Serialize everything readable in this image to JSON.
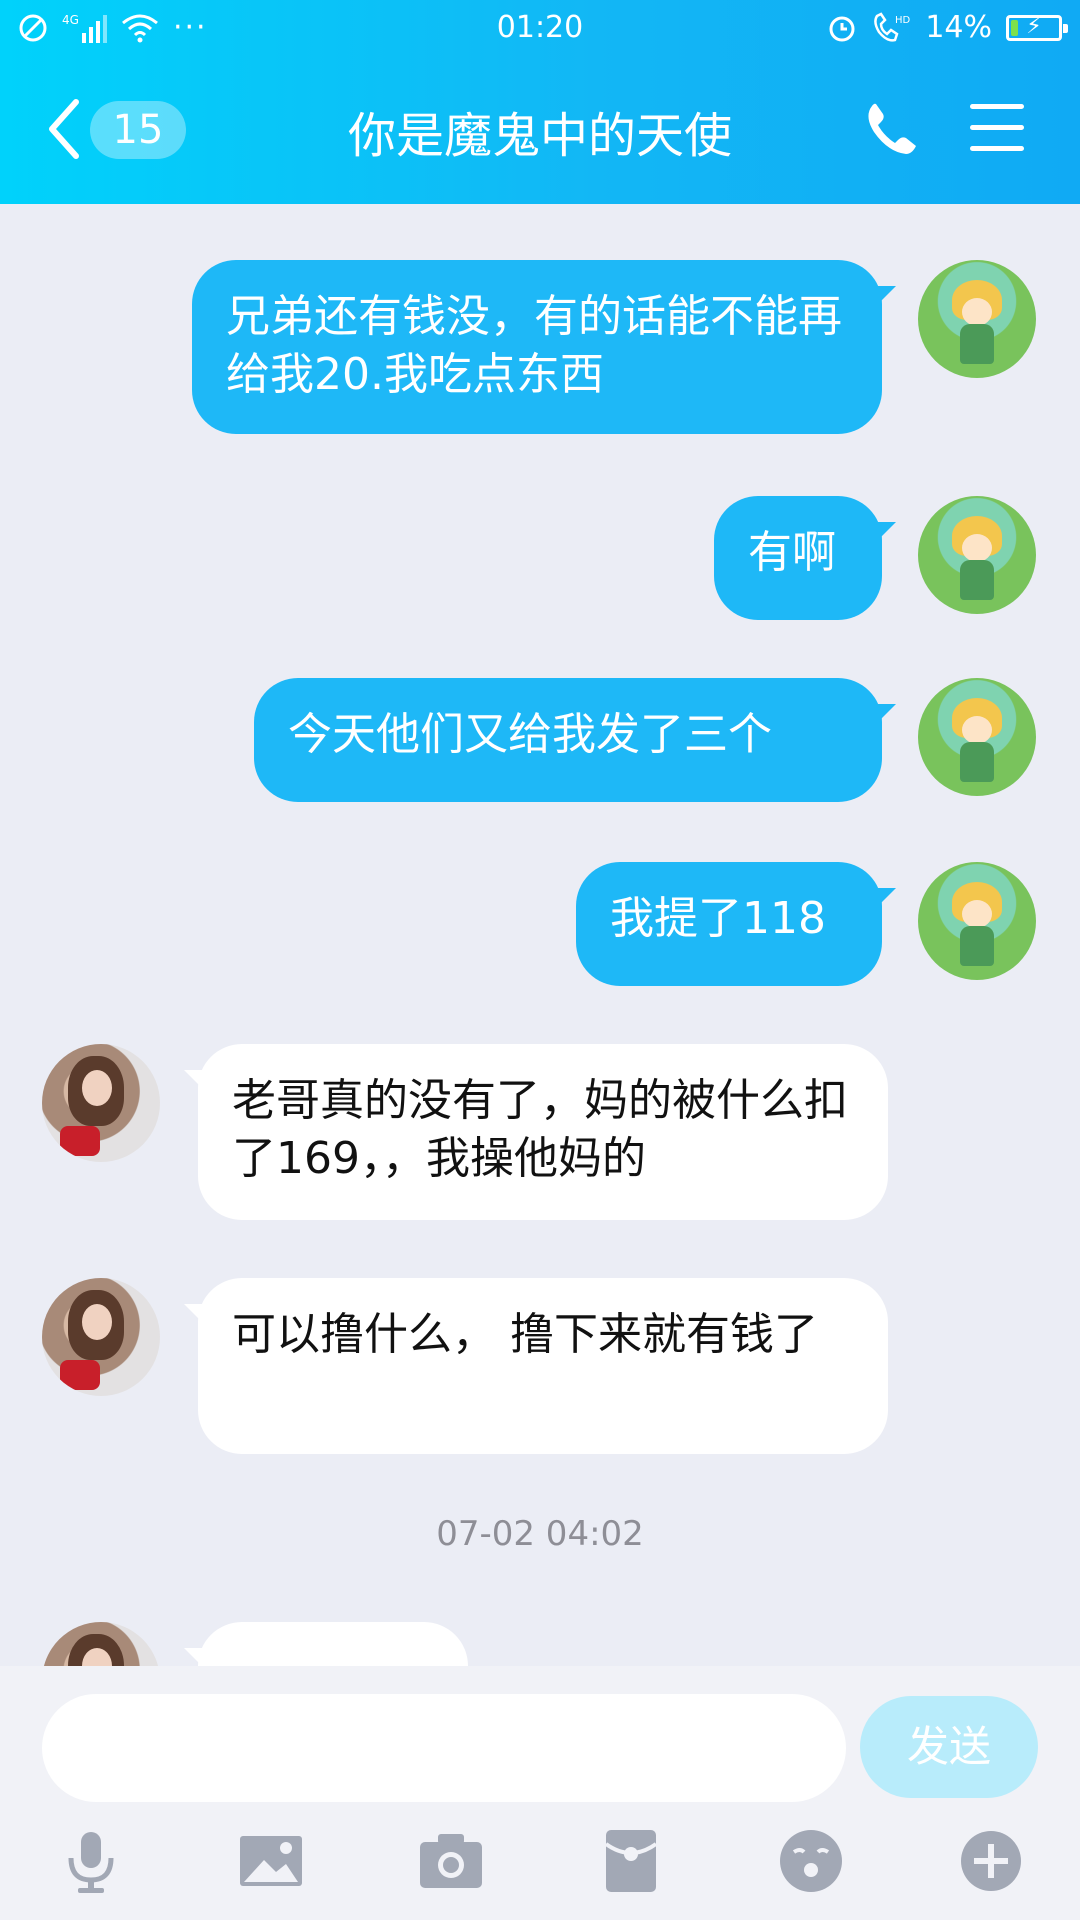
{
  "status_bar": {
    "time": "01:20",
    "network": "4G",
    "battery_text": "14%",
    "battery_level": 0.14
  },
  "header": {
    "back_count": "15",
    "title": "你是魔鬼中的天使"
  },
  "messages": [
    {
      "side": "me",
      "text": "兄弟还有钱没，有的话能不能再给我20.我吃点东西"
    },
    {
      "side": "me",
      "text": "有啊"
    },
    {
      "side": "me",
      "text": "今天他们又给我发了三个"
    },
    {
      "side": "me",
      "text": "我提了118"
    },
    {
      "side": "other",
      "text": "老哥真的没有了，妈的被什么扣了169，，我操他妈的"
    },
    {
      "side": "other",
      "text": "可以撸什么， 撸下来就有钱了"
    }
  ],
  "timestamp": "07-02 04:02",
  "composer": {
    "placeholder": "",
    "send_label": "发送"
  },
  "colors": {
    "header_start": "#00d2fb",
    "header_end": "#10aaf4",
    "my_bubble": "#1eb8f7",
    "their_bubble": "#ffffff",
    "background": "#ebedf5"
  }
}
